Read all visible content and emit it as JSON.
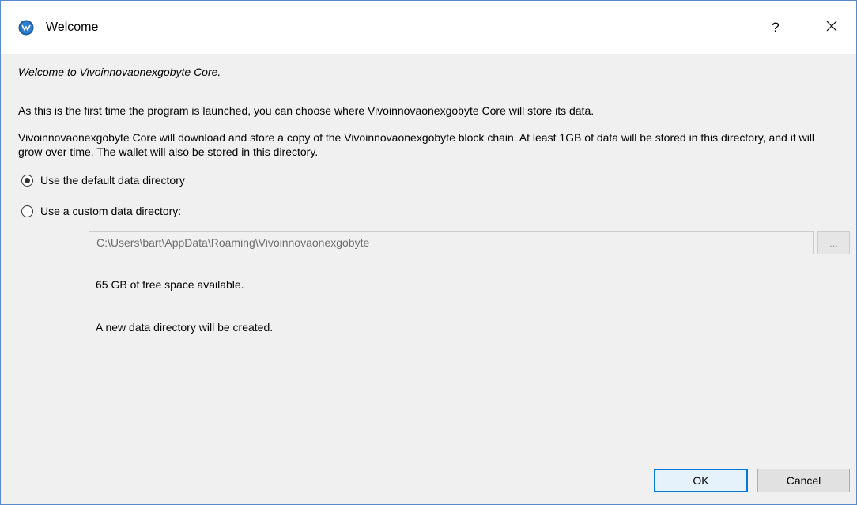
{
  "window": {
    "title": "Welcome",
    "help_label": "?",
    "close_icon": "close-icon",
    "app_icon": "app-logo-icon",
    "accent_color": "#0078d7"
  },
  "content": {
    "welcome": "Welcome to Vivoinnovaonexgobyte Core.",
    "intro": "As this is the first time the program is launched, you can choose where Vivoinnovaonexgobyte Core will store its data.",
    "description": "Vivoinnovaonexgobyte Core will download and store a copy of the Vivoinnovaonexgobyte block chain. At least 1GB of data will be stored in this directory, and it will grow over time. The wallet will also be stored in this directory."
  },
  "options": {
    "default_label": "Use the default data directory",
    "default_checked": true,
    "custom_label": "Use a custom data directory:",
    "custom_checked": false
  },
  "directory": {
    "path": "C:\\Users\\bart\\AppData\\Roaming\\Vivoinnovaonexgobyte",
    "browse_label": "...",
    "free_space": "65 GB of free space available.",
    "status": "A new data directory will be created."
  },
  "buttons": {
    "ok": "OK",
    "cancel": "Cancel"
  }
}
